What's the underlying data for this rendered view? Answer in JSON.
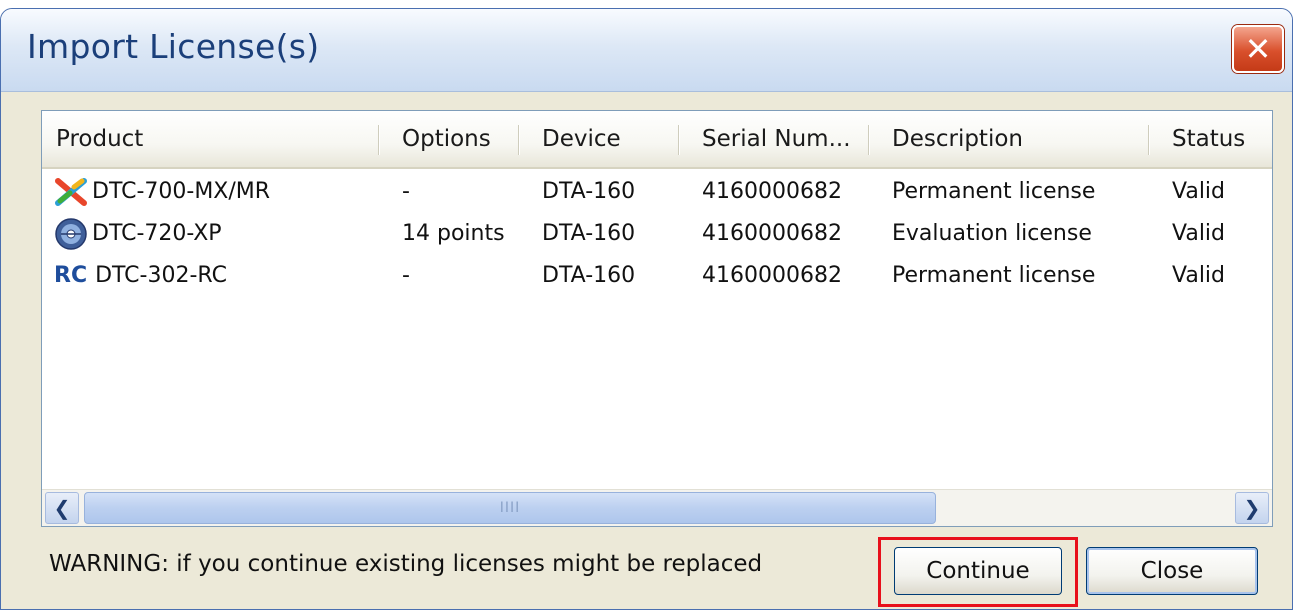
{
  "window": {
    "title": "Import License(s)",
    "close_glyph": "✕"
  },
  "list": {
    "columns": [
      "Product",
      "Options",
      "Device",
      "Serial Num...",
      "Description",
      "Status"
    ],
    "rows": [
      {
        "icon": "multicolor-x-icon",
        "product": "DTC-700-MX/MR",
        "options": "-",
        "device": "DTA-160",
        "serial": "4160000682",
        "description": "Permanent license",
        "status": "Valid"
      },
      {
        "icon": "globe-disc-icon",
        "product": "DTC-720-XP",
        "options": "14 points",
        "device": "DTA-160",
        "serial": "4160000682",
        "description": "Evaluation license",
        "status": "Valid"
      },
      {
        "icon": "rc-icon",
        "icon_text": "RC",
        "product": "DTC-302-RC",
        "options": "-",
        "device": "DTA-160",
        "serial": "4160000682",
        "description": "Permanent license",
        "status": "Valid"
      }
    ]
  },
  "scrollbar": {
    "left_glyph": "❮",
    "right_glyph": "❯",
    "thumb_grip": "IIII"
  },
  "footer": {
    "warning": "WARNING: if you continue existing licenses might be replaced",
    "continue_label": "Continue",
    "close_label": "Close"
  },
  "colors": {
    "title_text": "#1b3f7a",
    "highlight_border": "#e8101b",
    "dialog_bg": "#ece9d8"
  }
}
